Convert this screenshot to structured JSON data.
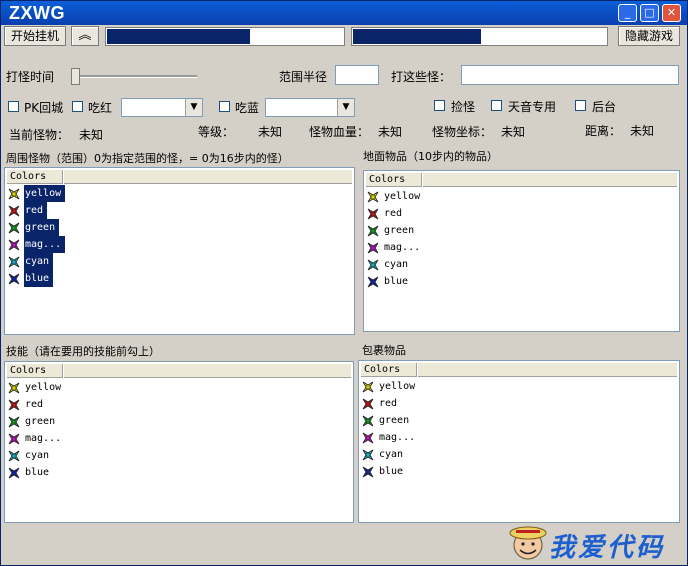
{
  "window": {
    "title": "ZXWG"
  },
  "toolbar": {
    "start_label": "开始挂机",
    "collapse_glyph": "≈",
    "hide_game_label": "隐藏游戏",
    "bar1_progress": 0.6,
    "bar2_progress": 0.5
  },
  "settings": {
    "kill_time_label": "打怪时间",
    "range_label": "范围半径",
    "range_value": "",
    "monsters_label": "打这些怪：",
    "monsters_value": "",
    "pk_return_label": "PK回城",
    "eat_red_label": "吃红",
    "eat_red_value": "",
    "eat_blue_label": "吃蓝",
    "eat_blue_value": "",
    "pickup_label": "捡怪",
    "tianyin_label": "天音专用",
    "background_label": "后台"
  },
  "status": {
    "current_monster_label": "当前怪物：",
    "current_monster_value": "未知",
    "level_label": "等级：",
    "level_value": "未知",
    "hp_label": "怪物血量：",
    "hp_value": "未知",
    "coords_label": "怪物坐标：",
    "coords_value": "未知",
    "distance_label": "距离：",
    "distance_value": "未知"
  },
  "panels": {
    "monsters_title": "周围怪物（范围）0为指定范围的怪，= 0为16步内的怪）",
    "ground_title": "地面物品（10步内的物品）",
    "skills_title": "技能（请在要用的技能前勾上）",
    "bag_title": "包裹物品",
    "column_header": "Colors",
    "items": [
      {
        "label": "yellow",
        "color": "#d8d800"
      },
      {
        "label": "red",
        "color": "#d01010"
      },
      {
        "label": "green",
        "color": "#10a020"
      },
      {
        "label": "mag...",
        "color": "#c010c0"
      },
      {
        "label": "cyan",
        "color": "#10b0c0"
      },
      {
        "label": "blue",
        "color": "#1020c0"
      }
    ]
  },
  "footer": {
    "logo_text": "我爱代码"
  }
}
